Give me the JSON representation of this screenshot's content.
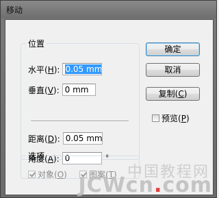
{
  "window": {
    "title": "移动"
  },
  "position_group": {
    "legend": "位置",
    "horizontal": {
      "label": "水平",
      "mnemonic": "H",
      "value": "0.05 mm"
    },
    "vertical": {
      "label": "垂直",
      "mnemonic": "V",
      "value": "0 mm"
    },
    "distance": {
      "label": "距离",
      "mnemonic": "D",
      "value": "0.05 mm"
    },
    "angle": {
      "label": "角度",
      "mnemonic": "A",
      "value": "0",
      "unit": "°"
    }
  },
  "options_group": {
    "legend": "选项",
    "objects": {
      "label": "对象",
      "mnemonic": "O",
      "checked": true,
      "disabled": true
    },
    "patterns": {
      "label": "图案",
      "mnemonic": "T",
      "checked": true,
      "disabled": true
    }
  },
  "buttons": {
    "ok": "确定",
    "cancel": "取消",
    "copy": {
      "label": "复制",
      "mnemonic": "C"
    }
  },
  "preview": {
    "label": "预览",
    "mnemonic": "P",
    "checked": false
  },
  "watermark": {
    "line1": "中国教程网",
    "line2_a": "JCWcn",
    "line2_dot": ".",
    "line2_b": "com"
  }
}
